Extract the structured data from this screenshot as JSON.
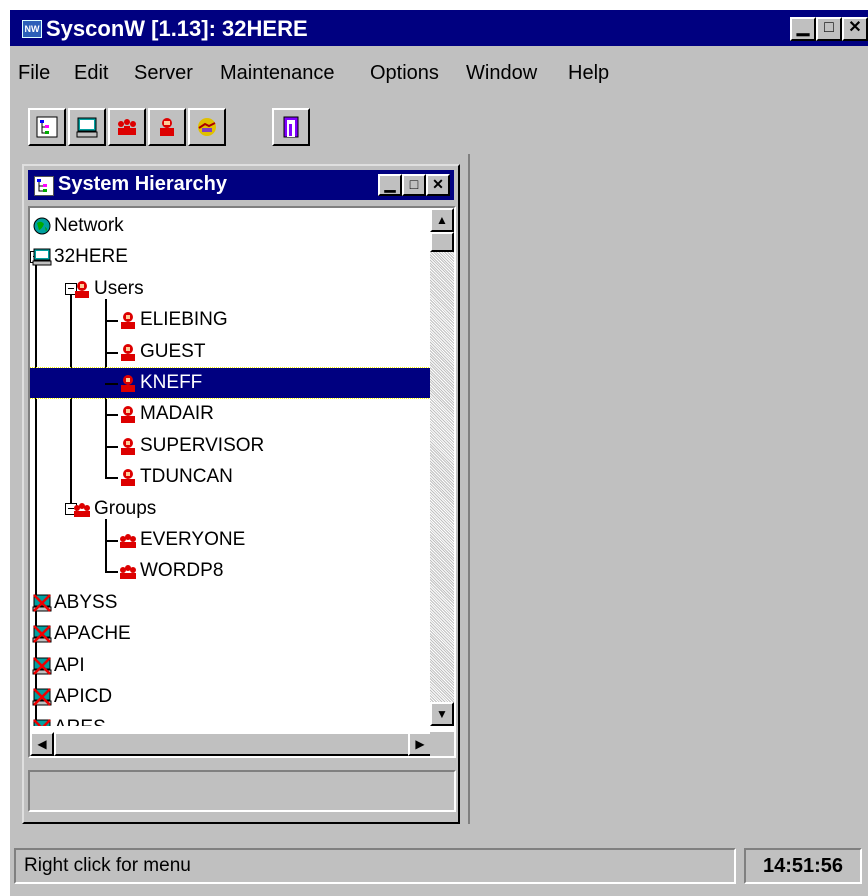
{
  "window": {
    "title": "SysconW [1.13]: 32HERE",
    "minimize": "_",
    "maximize": "□",
    "close": "✕"
  },
  "menu": [
    "File",
    "Edit",
    "Server",
    "Maintenance",
    "Options",
    "Window",
    "Help"
  ],
  "toolbar": {
    "buttons": [
      {
        "name": "hierarchy-button",
        "icon": "tree-icon"
      },
      {
        "name": "server-button",
        "icon": "server-icon"
      },
      {
        "name": "groups-button",
        "icon": "groups-icon"
      },
      {
        "name": "user-button",
        "icon": "user-icon"
      },
      {
        "name": "handshake-button",
        "icon": "handshake-icon"
      },
      {
        "name": "exit-button",
        "icon": "exit-door-icon"
      }
    ]
  },
  "hierarchy_window": {
    "title": "System Hierarchy",
    "minimize": "_",
    "maximize": "□",
    "close": "✕",
    "status": ""
  },
  "tree": {
    "nodes": [
      {
        "label": "Network",
        "icon": "globe-icon",
        "level": 0
      },
      {
        "label": "32HERE",
        "icon": "server-icon",
        "level": 0,
        "expanded": true
      },
      {
        "label": "Users",
        "icon": "user-icon",
        "level": 1,
        "expanded": true
      },
      {
        "label": "ELIEBING",
        "icon": "user-icon",
        "level": 2
      },
      {
        "label": "GUEST",
        "icon": "user-icon",
        "level": 2
      },
      {
        "label": "KNEFF",
        "icon": "user-icon",
        "level": 2,
        "selected": true
      },
      {
        "label": "MADAIR",
        "icon": "user-icon",
        "level": 2
      },
      {
        "label": "SUPERVISOR",
        "icon": "user-icon",
        "level": 2
      },
      {
        "label": "TDUNCAN",
        "icon": "user-icon",
        "level": 2
      },
      {
        "label": "Groups",
        "icon": "group-icon",
        "level": 1,
        "expanded": true
      },
      {
        "label": "EVERYONE",
        "icon": "group-icon",
        "level": 2
      },
      {
        "label": "WORDP8",
        "icon": "group-icon",
        "level": 2
      },
      {
        "label": "ABYSS",
        "icon": "server-disconnected-icon",
        "level": 0
      },
      {
        "label": "APACHE",
        "icon": "server-disconnected-icon",
        "level": 0
      },
      {
        "label": "API",
        "icon": "server-disconnected-icon",
        "level": 0
      },
      {
        "label": "APICD",
        "icon": "server-disconnected-icon",
        "level": 0
      },
      {
        "label": "ARES",
        "icon": "server-disconnected-icon",
        "level": 0
      }
    ]
  },
  "statusbar": {
    "hint": "Right click for menu",
    "clock": "14:51:56"
  }
}
